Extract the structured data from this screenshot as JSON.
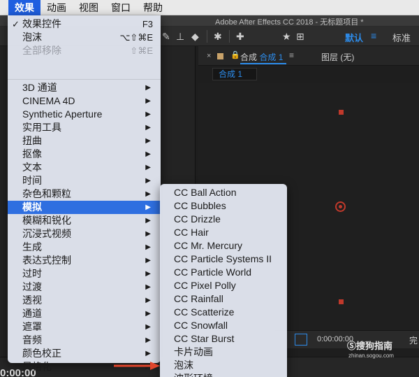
{
  "menubar": {
    "items": [
      {
        "label": "效果",
        "active": true
      },
      {
        "label": "动画"
      },
      {
        "label": "视图"
      },
      {
        "label": "窗口"
      },
      {
        "label": "帮助"
      }
    ]
  },
  "window": {
    "title": "Adobe After Effects CC 2018 - 无标题项目 *"
  },
  "toolbar": {
    "workspace_active": "默认",
    "workspace_standard": "标准"
  },
  "effect_menu": {
    "top_items": [
      {
        "label": "效果控件",
        "shortcut": "F3",
        "checked": true
      },
      {
        "label": "泡沫",
        "shortcut": "⌥⇧⌘E"
      },
      {
        "label": "全部移除",
        "shortcut": "⇧⌘E",
        "disabled": true
      }
    ],
    "categories": [
      "3D 通道",
      "CINEMA 4D",
      "Synthetic Aperture",
      "实用工具",
      "扭曲",
      "抠像",
      "文本",
      "时间",
      "杂色和颗粒",
      "模拟",
      "模糊和锐化",
      "沉浸式视频",
      "生成",
      "表达式控制",
      "过时",
      "过渡",
      "透视",
      "通道",
      "遮罩",
      "音频",
      "颜色校正",
      "风格化"
    ],
    "highlighted": "模拟"
  },
  "simulate_submenu": {
    "items": [
      "CC Ball Action",
      "CC Bubbles",
      "CC Drizzle",
      "CC Hair",
      "CC Mr. Mercury",
      "CC Particle Systems II",
      "CC Particle World",
      "CC Pixel Polly",
      "CC Rainfall",
      "CC Scatterize",
      "CC Snowfall",
      "CC Star Burst",
      "卡片动画",
      "泡沫",
      "波形环境"
    ]
  },
  "comp_panel": {
    "tab_prefix": "合成",
    "tab_name": "合成 1",
    "layer_label": "图层 (无)",
    "viewer_tab": "合成 1",
    "timecode": "0:00:00:00"
  },
  "timeline": {
    "timecode": "0:00:00"
  },
  "status": {
    "full_label": "完"
  },
  "watermark": {
    "brand": "搜狗指南",
    "url": "zhinan.sogou.com"
  },
  "colors": {
    "highlight": "#2f6fe0",
    "accent_blue": "#2d8ceb",
    "arrow": "#e0452b",
    "marker_red": "#c0392b"
  }
}
